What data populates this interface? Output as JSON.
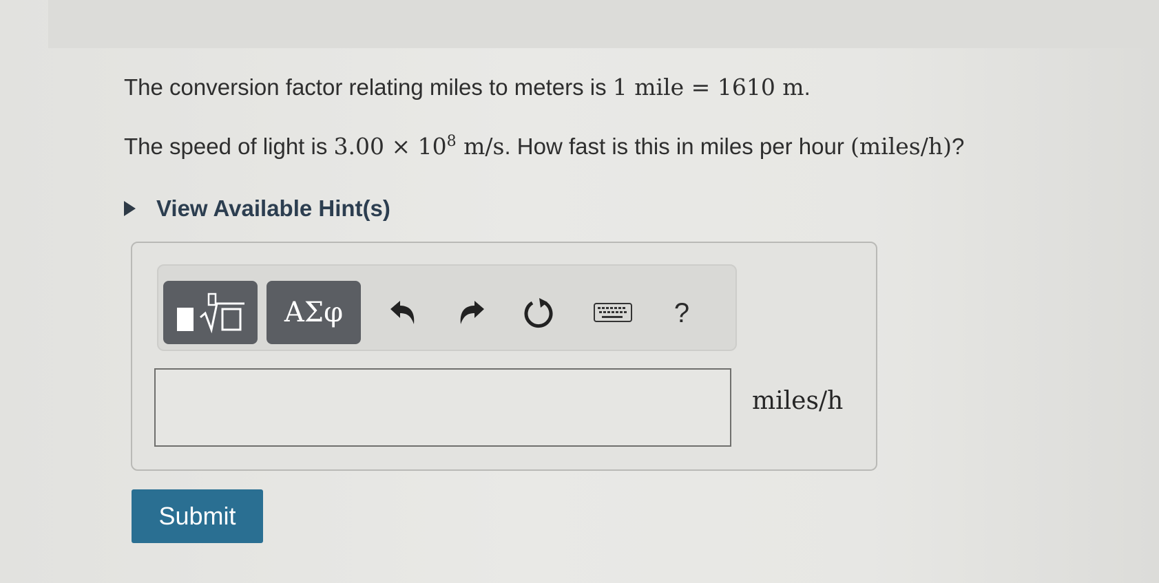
{
  "question": {
    "line1": {
      "text_before": "The conversion factor relating miles to meters is ",
      "math": "1 mile = 1610 m",
      "text_after": "."
    },
    "line2": {
      "text_before": "The speed of light is ",
      "math_base": "3.00 × 10",
      "math_exp": "8",
      "math_unit": " m/s",
      "text_middle": ". How fast is this in miles per hour ",
      "math_paren": "(miles/h)",
      "text_after": "?"
    }
  },
  "hint": {
    "label": "View Available Hint(s)"
  },
  "toolbar": {
    "templates_icon": "templates-icon",
    "symbols_label": "ΑΣφ",
    "undo_icon": "undo-icon",
    "redo_icon": "redo-icon",
    "reset_icon": "reset-icon",
    "keyboard_icon": "keyboard-icon",
    "help_label": "?"
  },
  "answer": {
    "value": "",
    "placeholder": "",
    "unit": "miles/h"
  },
  "submit": {
    "label": "Submit"
  },
  "colors": {
    "background": "#e4e4e1",
    "submit_button": "#2a6f92",
    "toolbar_button": "#5b5e63",
    "hint_text": "#2c3e50"
  }
}
